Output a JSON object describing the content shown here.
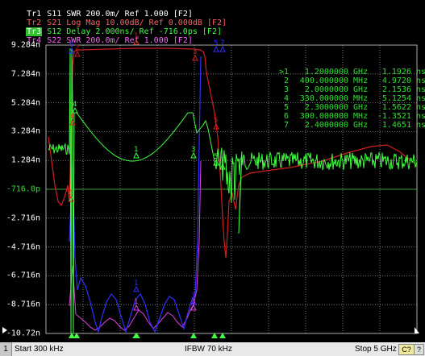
{
  "traces": [
    {
      "id": "Tr1",
      "param": "S11",
      "format": "SWR",
      "scale": "200.0m/",
      "ref": "Ref 1.000",
      "f": "[F2]",
      "color": "#ffff40"
    },
    {
      "id": "Tr2",
      "param": "S21",
      "format": "Log Mag",
      "scale": "10.00dB/",
      "ref": "Ref 0.000dB",
      "f": "[F2]",
      "color": "#ff6060"
    },
    {
      "id": "Tr3",
      "param": "S12",
      "format": "Delay",
      "scale": "2.000ns/",
      "ref": "Ref -716.0ps",
      "f": "[F2]",
      "color": "#40ff40"
    },
    {
      "id": "Tr4",
      "param": "S22",
      "format": "SWR",
      "scale": "200.0m/",
      "ref": "Ref 1.000",
      "f": "[F2]",
      "color": "#ff60ff"
    }
  ],
  "y_ticks": [
    "9.284n",
    "7.284n",
    "5.284n",
    "3.284n",
    "1.284n",
    "-716.0p",
    "-2.716n",
    "-4.716n",
    "-6.716n",
    "-8.716n",
    "-10.72n"
  ],
  "ref_tick_index": 5,
  "markers": [
    {
      "num": ">1",
      "freq": "1.2000000",
      "unit": "GHz",
      "value": "1.1926 ns"
    },
    {
      "num": "2",
      "freq": "400.000000",
      "unit": "MHz",
      "value": "4.9720 ns"
    },
    {
      "num": "3",
      "freq": "2.0000000",
      "unit": "GHz",
      "value": "2.1536 ns"
    },
    {
      "num": "4",
      "freq": "330.000000",
      "unit": "MHz",
      "value": "5.1254 ns"
    },
    {
      "num": "5",
      "freq": "2.3000000",
      "unit": "GHz",
      "value": "1.5622 ns"
    },
    {
      "num": "6",
      "freq": "300.000000",
      "unit": "MHz",
      "value": "-1.3521 ns"
    },
    {
      "num": "7",
      "freq": "2.4000000",
      "unit": "GHz",
      "value": "1.4651 ns"
    }
  ],
  "status": {
    "channel": "1",
    "start": "Start 300 kHz",
    "ifbw": "IFBW 70 kHz",
    "stop": "Stop 5 GHz",
    "badge": "C?",
    "corner_icon": "?"
  },
  "colors": {
    "grid": "#888888",
    "tr1": "#3030ff",
    "tr2": "#d02020",
    "tr3": "#40ff40",
    "tr4": "#e040e0"
  }
}
